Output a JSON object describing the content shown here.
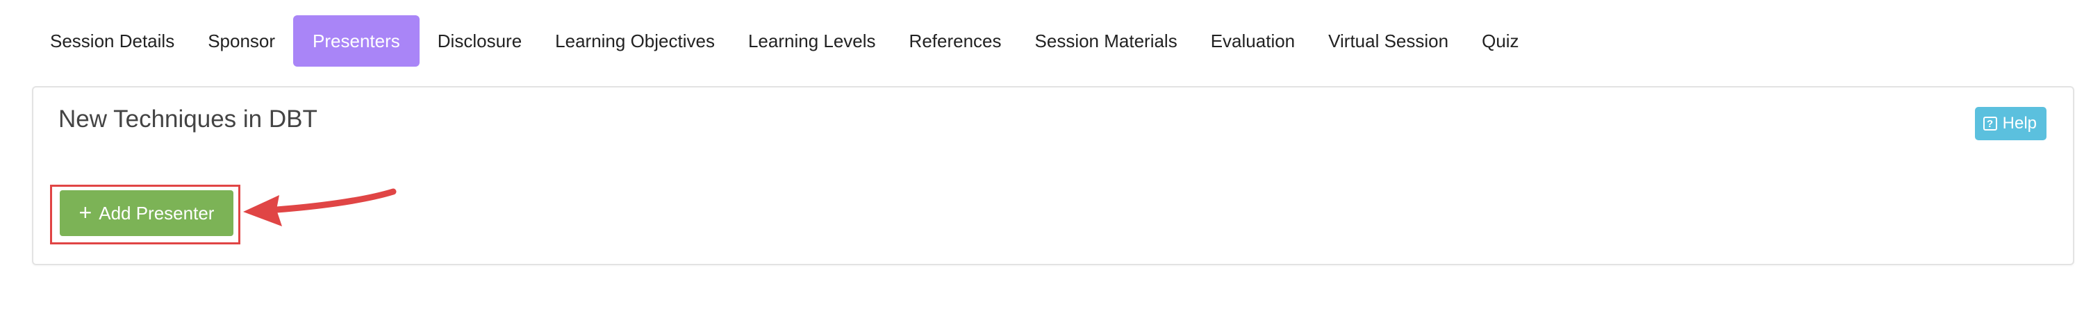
{
  "tabs": [
    {
      "label": "Session Details",
      "active": false
    },
    {
      "label": "Sponsor",
      "active": false
    },
    {
      "label": "Presenters",
      "active": true
    },
    {
      "label": "Disclosure",
      "active": false
    },
    {
      "label": "Learning Objectives",
      "active": false
    },
    {
      "label": "Learning Levels",
      "active": false
    },
    {
      "label": "References",
      "active": false
    },
    {
      "label": "Session Materials",
      "active": false
    },
    {
      "label": "Evaluation",
      "active": false
    },
    {
      "label": "Virtual Session",
      "active": false
    },
    {
      "label": "Quiz",
      "active": false
    }
  ],
  "card": {
    "title": "New Techniques in DBT",
    "help_label": "Help",
    "help_icon_glyph": "?",
    "add_presenter_label": "Add Presenter",
    "add_presenter_icon_glyph": "+"
  },
  "colors": {
    "active_tab": "#a985f7",
    "help_button": "#5bc0de",
    "add_button": "#7cb356",
    "annotation": "#e04545"
  }
}
